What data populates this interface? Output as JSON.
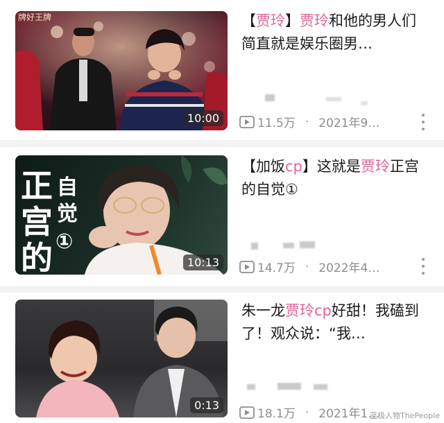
{
  "videos": [
    {
      "title_parts": [
        {
          "text": "【",
          "pink": false
        },
        {
          "text": "贾玲",
          "pink": true
        },
        {
          "text": "】",
          "pink": false
        },
        {
          "text": "贾玲",
          "pink": true
        },
        {
          "text": "和他的男人们 简直就是娱乐圈男…",
          "pink": false
        }
      ],
      "views": "11.5万",
      "date": "2021年9…",
      "duration": "10:00",
      "thumb_caption": "牌好王牌"
    },
    {
      "title_parts": [
        {
          "text": "【加饭",
          "pink": false
        },
        {
          "text": "cp",
          "pink": true
        },
        {
          "text": "】这就是",
          "pink": false
        },
        {
          "text": "贾玲",
          "pink": true
        },
        {
          "text": "正宫的自觉①",
          "pink": false
        }
      ],
      "views": "14.7万",
      "date": "2022年4…",
      "duration": "10:13",
      "thumb_text_big": [
        "正",
        "宫",
        "的"
      ],
      "thumb_text_small": [
        "自",
        "觉",
        "①"
      ]
    },
    {
      "title_parts": [
        {
          "text": "朱一龙",
          "pink": false
        },
        {
          "text": "贾玲cp",
          "pink": true
        },
        {
          "text": "好甜！我磕到了！观众说：“我…",
          "pink": false
        }
      ],
      "views": "18.1万",
      "date": "2021年1…",
      "duration": "0:13"
    }
  ],
  "separator": "·",
  "watermark": "蓝极人物ThePeople"
}
